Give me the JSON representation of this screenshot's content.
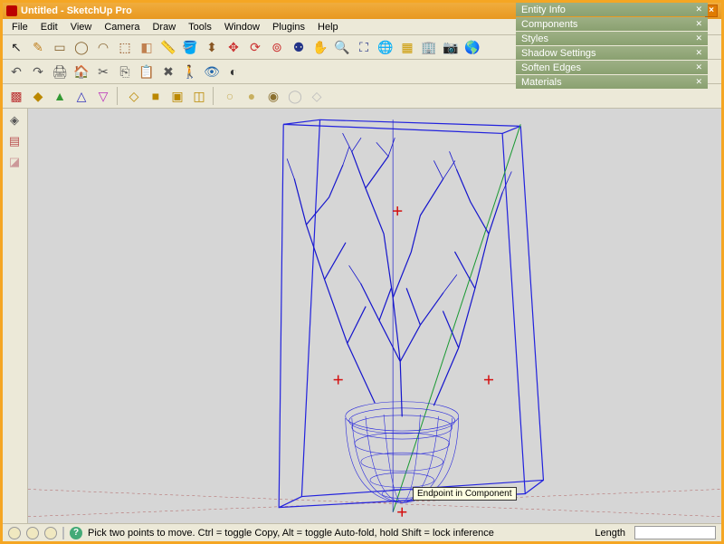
{
  "title": "Untitled - SketchUp Pro",
  "menu": [
    "File",
    "Edit",
    "View",
    "Camera",
    "Draw",
    "Tools",
    "Window",
    "Plugins",
    "Help"
  ],
  "panels": [
    "Entity Info",
    "Components",
    "Styles",
    "Shadow Settings",
    "Soften Edges",
    "Materials"
  ],
  "toolbar_row1": [
    {
      "name": "select-tool",
      "glyph": "↖",
      "color": "#222"
    },
    {
      "name": "line-tool",
      "glyph": "✎",
      "color": "#c08020"
    },
    {
      "name": "rectangle-tool",
      "glyph": "▭",
      "color": "#886633"
    },
    {
      "name": "circle-tool",
      "glyph": "◯",
      "color": "#886633"
    },
    {
      "name": "arc-tool",
      "glyph": "◠",
      "color": "#886633"
    },
    {
      "name": "make-component",
      "glyph": "⬚",
      "color": "#8b4513"
    },
    {
      "name": "eraser-tool",
      "glyph": "◧",
      "color": "#c08050"
    },
    {
      "name": "tape-measure-tool",
      "glyph": "📏",
      "color": "#888"
    },
    {
      "name": "paint-bucket-tool",
      "glyph": "🪣",
      "color": "#b55"
    },
    {
      "name": "push-pull-tool",
      "glyph": "⬍",
      "color": "#885522"
    },
    {
      "name": "move-tool",
      "glyph": "✥",
      "color": "#c33"
    },
    {
      "name": "rotate-tool",
      "glyph": "⟳",
      "color": "#c33"
    },
    {
      "name": "offset-tool",
      "glyph": "⊚",
      "color": "#c33"
    },
    {
      "name": "orbit-tool",
      "glyph": "⚉",
      "color": "#238"
    },
    {
      "name": "pan-tool",
      "glyph": "✋",
      "color": "#c90"
    },
    {
      "name": "zoom-tool",
      "glyph": "🔍",
      "color": "#238"
    },
    {
      "name": "zoom-extents-tool",
      "glyph": "⛶",
      "color": "#238"
    },
    {
      "name": "add-location",
      "glyph": "🌐",
      "color": "#c90"
    },
    {
      "name": "toggle-terrain",
      "glyph": "▦",
      "color": "#c90"
    },
    {
      "name": "add-building",
      "glyph": "🏢",
      "color": "#888"
    },
    {
      "name": "photo-textures",
      "glyph": "📷",
      "color": "#888"
    },
    {
      "name": "preview-ge",
      "glyph": "🌎",
      "color": "#26a"
    }
  ],
  "toolbar_row2": [
    {
      "name": "undo-tool",
      "glyph": "↶",
      "color": "#555"
    },
    {
      "name": "redo-tool",
      "glyph": "↷",
      "color": "#555"
    },
    {
      "name": "print-tool",
      "glyph": "🖨",
      "color": "#555"
    },
    {
      "name": "model-info",
      "glyph": "🏠",
      "color": "#555"
    },
    {
      "name": "cut-tool",
      "glyph": "✂",
      "color": "#555"
    },
    {
      "name": "copy-tool",
      "glyph": "⎘",
      "color": "#555"
    },
    {
      "name": "paste-tool",
      "glyph": "📋",
      "color": "#555"
    },
    {
      "name": "erase-tool",
      "glyph": "✖",
      "color": "#555"
    },
    {
      "name": "walk-tool",
      "glyph": "🚶",
      "color": "#26a"
    },
    {
      "name": "look-around-tool",
      "glyph": "👁",
      "color": "#26a"
    },
    {
      "name": "section-plane",
      "glyph": "◐",
      "color": "#333"
    }
  ],
  "toolbar_row3": [
    {
      "name": "sandbox-1",
      "glyph": "▩",
      "color": "#b33"
    },
    {
      "name": "sandbox-2",
      "glyph": "◆",
      "color": "#b80"
    },
    {
      "name": "sandbox-3",
      "glyph": "▲",
      "color": "#393"
    },
    {
      "name": "sandbox-4",
      "glyph": "△",
      "color": "#33b"
    },
    {
      "name": "sandbox-5",
      "glyph": "▽",
      "color": "#b3b"
    },
    {
      "sep": true
    },
    {
      "name": "style-iso",
      "glyph": "◇",
      "color": "#b80"
    },
    {
      "name": "style-top",
      "glyph": "■",
      "color": "#b80"
    },
    {
      "name": "style-front",
      "glyph": "▣",
      "color": "#b80"
    },
    {
      "name": "style-right",
      "glyph": "◫",
      "color": "#b80"
    },
    {
      "sep": true
    },
    {
      "name": "render-1",
      "glyph": "○",
      "color": "#c8b060"
    },
    {
      "name": "render-2",
      "glyph": "●",
      "color": "#c8b060"
    },
    {
      "name": "render-3",
      "glyph": "◉",
      "color": "#8b7030"
    },
    {
      "name": "render-4",
      "glyph": "◯",
      "color": "#bbb"
    },
    {
      "name": "render-5",
      "glyph": "◇",
      "color": "#bbb"
    }
  ],
  "side_tray": [
    {
      "name": "outliner-icon",
      "glyph": "◈",
      "color": "#555"
    },
    {
      "name": "layers-icon",
      "glyph": "▤",
      "color": "#b55"
    },
    {
      "name": "shadows-icon",
      "glyph": "◪",
      "color": "#c99"
    }
  ],
  "tooltip_text": "Endpoint in Component",
  "status": {
    "hint": "Pick two points to move.  Ctrl = toggle Copy, Alt = toggle Auto-fold, hold Shift = lock inference",
    "length_label": "Length"
  },
  "reference_marks": [
    "+",
    "+",
    "+",
    "+"
  ]
}
